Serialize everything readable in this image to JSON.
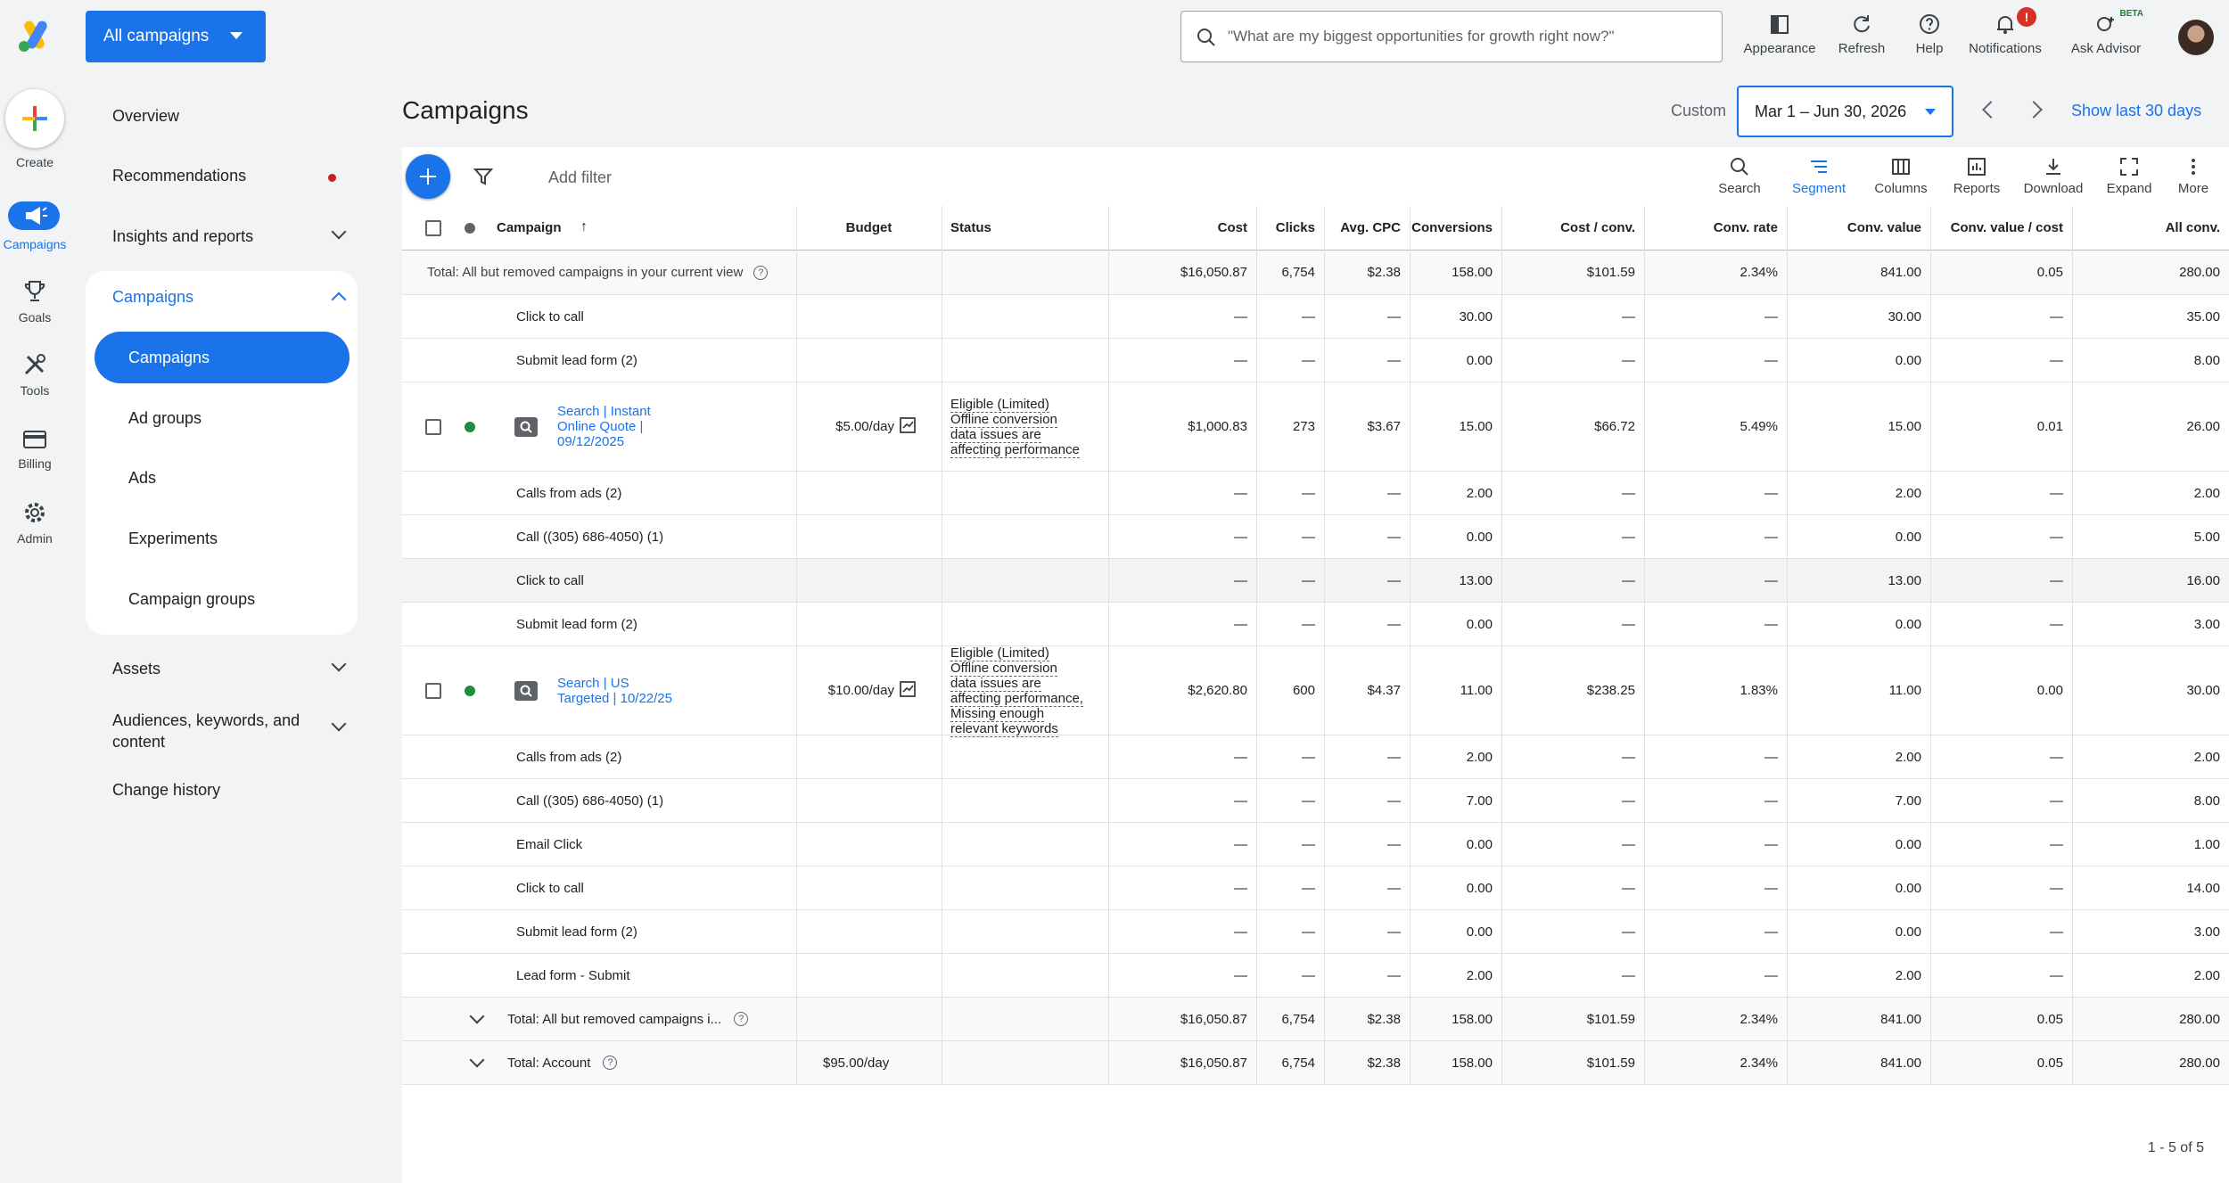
{
  "header": {
    "account_button": "All campaigns",
    "search_placeholder": "\"What are my biggest opportunities for growth right now?\"",
    "tools": [
      {
        "label": "Appearance",
        "icon": "appearance-icon"
      },
      {
        "label": "Refresh",
        "icon": "refresh-icon"
      },
      {
        "label": "Help",
        "icon": "help-icon"
      },
      {
        "label": "Notifications",
        "icon": "bell-icon",
        "badge": "!"
      },
      {
        "label": "Ask Advisor",
        "icon": "advisor-icon",
        "tag": "BETA"
      }
    ]
  },
  "rail": {
    "items": [
      {
        "label": "Create",
        "icon": "plus-icon"
      },
      {
        "label": "Campaigns",
        "icon": "megaphone-icon",
        "active": true
      },
      {
        "label": "Goals",
        "icon": "trophy-icon"
      },
      {
        "label": "Tools",
        "icon": "tools-icon"
      },
      {
        "label": "Billing",
        "icon": "card-icon"
      },
      {
        "label": "Admin",
        "icon": "gear-icon"
      }
    ]
  },
  "nav": {
    "overview": "Overview",
    "recommendations": "Recommendations",
    "insights": "Insights and reports",
    "campaigns_group": "Campaigns",
    "sub": [
      "Campaigns",
      "Ad groups",
      "Ads",
      "Experiments",
      "Campaign groups"
    ],
    "assets": "Assets",
    "audiences": [
      "Audiences, keywords, and",
      "content"
    ],
    "change_history": "Change history"
  },
  "main": {
    "title": "Campaigns",
    "date_mode": "Custom",
    "date_range": "Mar 1 – Jun 30, 2026",
    "show_last": "Show last 30 days",
    "add_filter": "Add filter",
    "toolbar": [
      "Search",
      "Segment",
      "Columns",
      "Reports",
      "Download",
      "Expand",
      "More"
    ],
    "pagination": "1 - 5 of 5"
  },
  "table": {
    "columns": [
      "Campaign",
      "Budget",
      "Status",
      "Cost",
      "Clicks",
      "Avg. CPC",
      "Conversions",
      "Cost / conv.",
      "Conv. rate",
      "Conv. value",
      "Conv. value / cost",
      "All conv."
    ],
    "rows": [
      {
        "kind": "total",
        "label": "Total: All but removed campaigns in your current view",
        "cells": [
          "$16,050.87",
          "6,754",
          "$2.38",
          "158.00",
          "$101.59",
          "2.34%",
          "841.00",
          "0.05",
          "280.00"
        ]
      },
      {
        "kind": "seg",
        "label": "Click to call",
        "cells": [
          "—",
          "—",
          "—",
          "30.00",
          "—",
          "—",
          "30.00",
          "—",
          "35.00"
        ]
      },
      {
        "kind": "seg",
        "label": "Submit lead form (2)",
        "cells": [
          "—",
          "—",
          "—",
          "0.00",
          "—",
          "—",
          "0.00",
          "—",
          "8.00"
        ]
      },
      {
        "kind": "campaign",
        "label": "Search | Instant Online Quote | 09/12/2025",
        "budget": "$5.00/day",
        "status": [
          "Eligible (Limited)",
          "Offline conversion data issues are affecting performance"
        ],
        "cells": [
          "$1,000.83",
          "273",
          "$3.67",
          "15.00",
          "$66.72",
          "5.49%",
          "15.00",
          "0.01",
          "26.00"
        ]
      },
      {
        "kind": "seg",
        "label": "Calls from ads (2)",
        "cells": [
          "—",
          "—",
          "—",
          "2.00",
          "—",
          "—",
          "2.00",
          "—",
          "2.00"
        ]
      },
      {
        "kind": "seg",
        "label": "Call ((305) 686-4050) (1)",
        "cells": [
          "—",
          "—",
          "—",
          "0.00",
          "—",
          "—",
          "0.00",
          "—",
          "5.00"
        ]
      },
      {
        "kind": "seg-hl",
        "label": "Click to call",
        "cells": [
          "—",
          "—",
          "—",
          "13.00",
          "—",
          "—",
          "13.00",
          "—",
          "16.00"
        ]
      },
      {
        "kind": "seg",
        "label": "Submit lead form (2)",
        "cells": [
          "—",
          "—",
          "—",
          "0.00",
          "—",
          "—",
          "0.00",
          "—",
          "3.00"
        ]
      },
      {
        "kind": "campaign",
        "label": "Search | US Targeted | 10/22/25",
        "budget": "$10.00/day",
        "status": [
          "Eligible (Limited)",
          "Offline conversion data issues are affecting performance, Missing enough relevant keywords"
        ],
        "cells": [
          "$2,620.80",
          "600",
          "$4.37",
          "11.00",
          "$238.25",
          "1.83%",
          "11.00",
          "0.00",
          "30.00"
        ]
      },
      {
        "kind": "seg",
        "label": "Calls from ads (2)",
        "cells": [
          "—",
          "—",
          "—",
          "2.00",
          "—",
          "—",
          "2.00",
          "—",
          "2.00"
        ]
      },
      {
        "kind": "seg",
        "label": "Call ((305) 686-4050) (1)",
        "cells": [
          "—",
          "—",
          "—",
          "7.00",
          "—",
          "—",
          "7.00",
          "—",
          "8.00"
        ]
      },
      {
        "kind": "seg",
        "label": "Email Click",
        "cells": [
          "—",
          "—",
          "—",
          "0.00",
          "—",
          "—",
          "0.00",
          "—",
          "1.00"
        ]
      },
      {
        "kind": "seg",
        "label": "Click to call",
        "cells": [
          "—",
          "—",
          "—",
          "0.00",
          "—",
          "—",
          "0.00",
          "—",
          "14.00"
        ]
      },
      {
        "kind": "seg",
        "label": "Submit lead form (2)",
        "cells": [
          "—",
          "—",
          "—",
          "0.00",
          "—",
          "—",
          "0.00",
          "—",
          "3.00"
        ]
      },
      {
        "kind": "seg",
        "label": "Lead form - Submit",
        "cells": [
          "—",
          "—",
          "—",
          "2.00",
          "—",
          "—",
          "2.00",
          "—",
          "2.00"
        ]
      },
      {
        "kind": "foot",
        "label": "Total: All but removed campaigns i...",
        "budget": "",
        "cells": [
          "$16,050.87",
          "6,754",
          "$2.38",
          "158.00",
          "$101.59",
          "2.34%",
          "841.00",
          "0.05",
          "280.00"
        ]
      },
      {
        "kind": "foot",
        "label": "Total: Account",
        "budget": "$95.00/day",
        "cells": [
          "$16,050.87",
          "6,754",
          "$2.38",
          "158.00",
          "$101.59",
          "2.34%",
          "841.00",
          "0.05",
          "280.00"
        ]
      }
    ]
  },
  "colors": {
    "accent": "#1a73e8",
    "status_green": "#1e8e3e",
    "alert_red": "#d93025"
  }
}
